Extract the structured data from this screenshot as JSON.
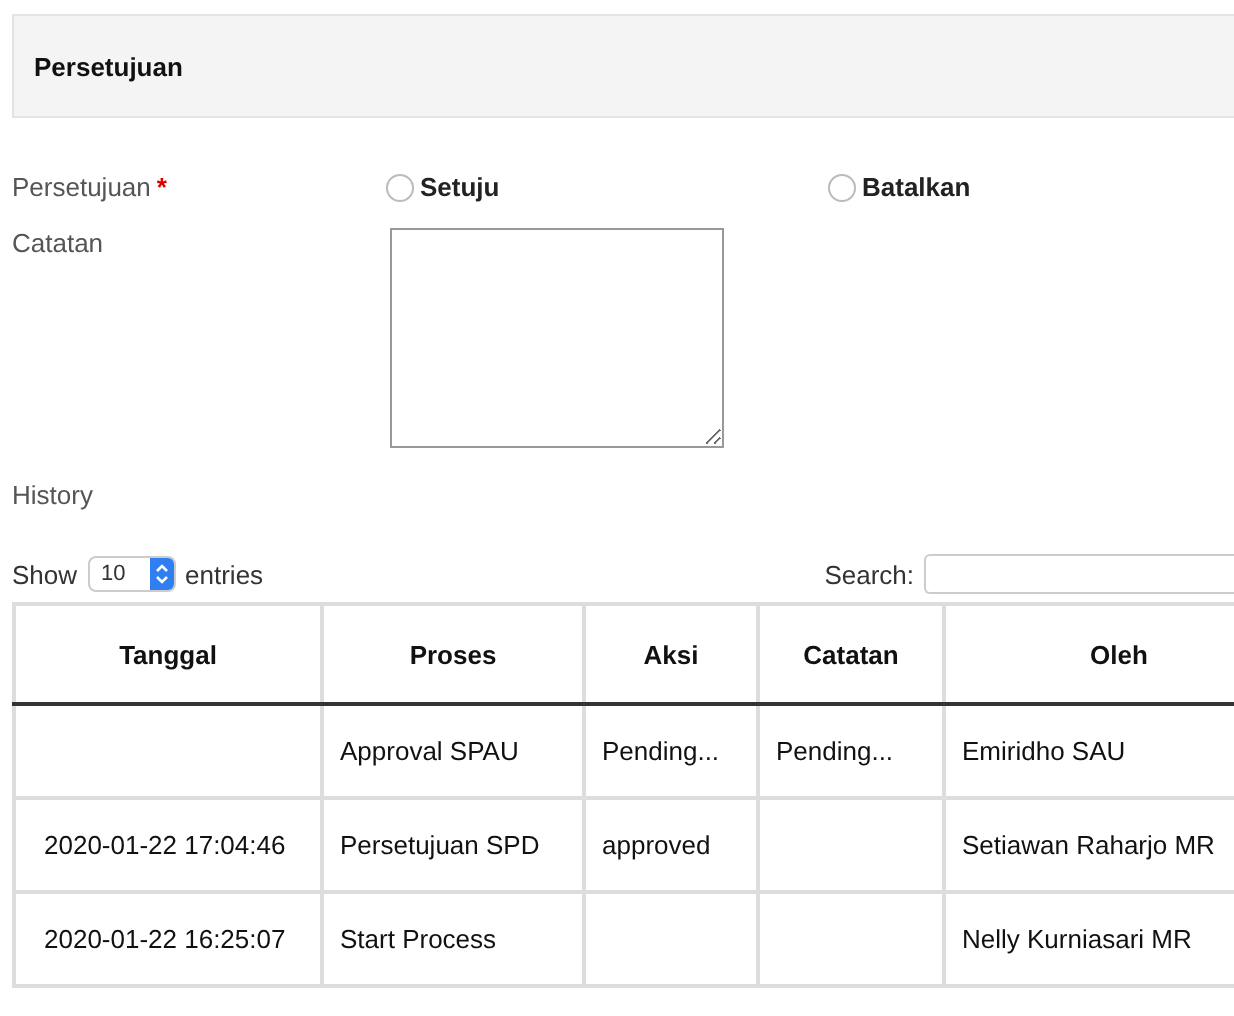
{
  "panel": {
    "title": "Persetujuan"
  },
  "approval": {
    "label": "Persetujuan",
    "required_mark": "*",
    "options": [
      {
        "label": "Setuju",
        "selected": false
      },
      {
        "label": "Batalkan",
        "selected": false
      }
    ]
  },
  "notes": {
    "label": "Catatan"
  },
  "history": {
    "label": "History",
    "length": {
      "prefix": "Show",
      "value": "10",
      "suffix": "entries"
    },
    "search": {
      "label": "Search:"
    },
    "columns": [
      "Tanggal",
      "Proses",
      "Aksi",
      "Catatan",
      "Oleh"
    ],
    "rows": [
      [
        "",
        "Approval SPAU",
        "Pending...",
        "Pending...",
        "Emiridho SAU"
      ],
      [
        "2020-01-22 17:04:46",
        "Persetujuan SPD",
        "approved",
        "",
        "Setiawan Raharjo MR"
      ],
      [
        "2020-01-22 16:25:07",
        "Start Process",
        "",
        "",
        "Nelly Kurniasari MR"
      ]
    ]
  }
}
